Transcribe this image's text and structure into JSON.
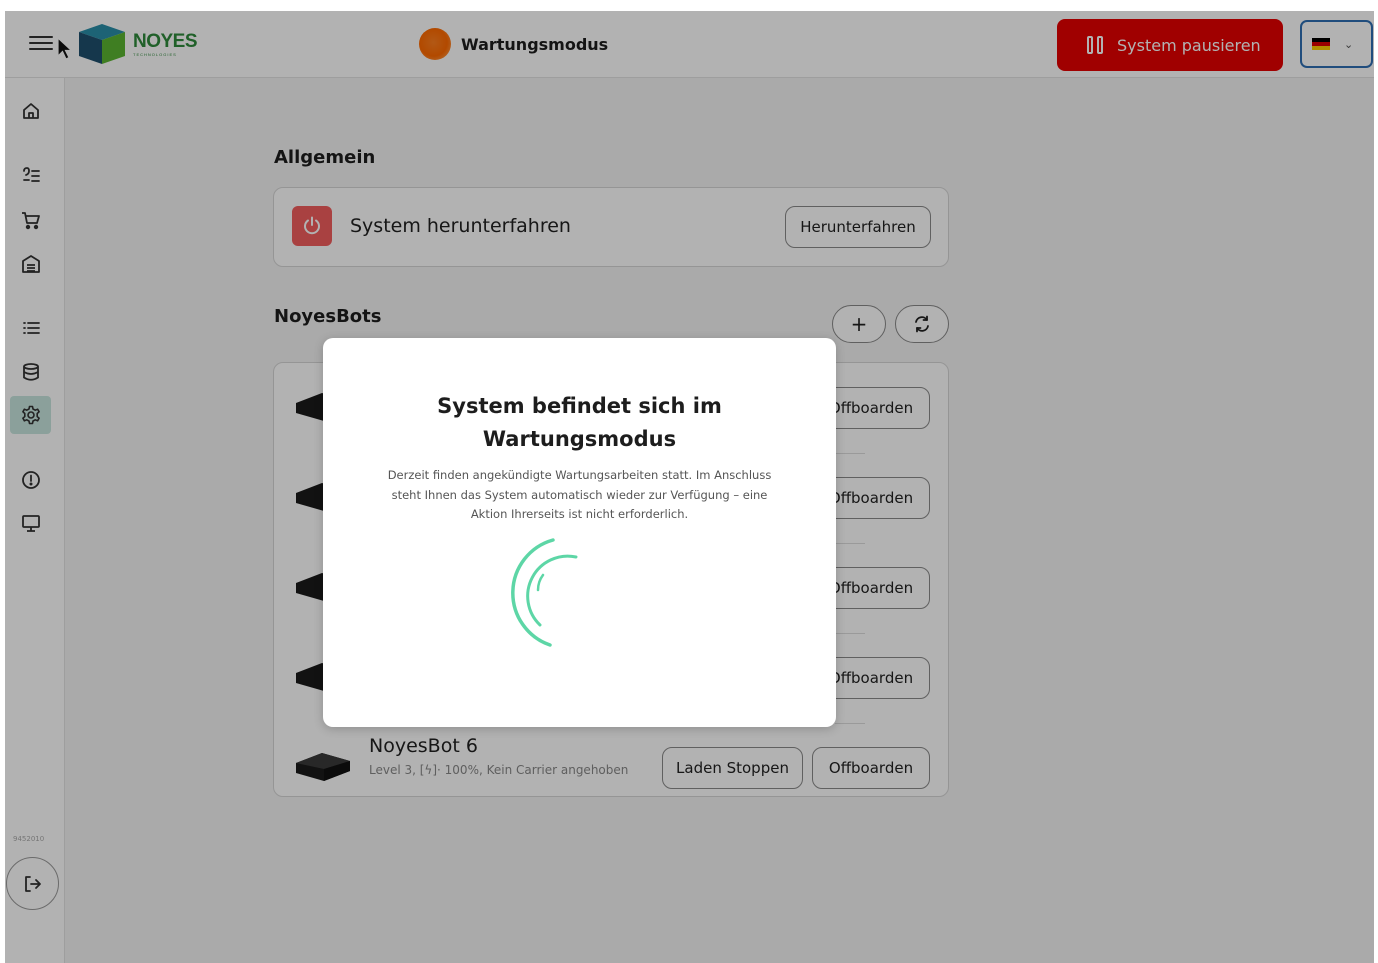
{
  "header": {
    "logo_name": "NOYES",
    "logo_sub": "TECHNOLOGIES",
    "mode_label": "Wartungsmodus",
    "pause_label": "System pausieren",
    "language": "de",
    "colors": {
      "pause": "#e60000",
      "mode_dot": "#ff6a00",
      "accent": "#2e8a3c"
    }
  },
  "sidebar": {
    "items": [
      {
        "icon": "home-icon",
        "active": false
      },
      {
        "icon": "order-list-icon",
        "active": false
      },
      {
        "icon": "cart-icon",
        "active": false
      },
      {
        "icon": "storage-icon",
        "active": false
      },
      {
        "icon": "list-icon",
        "active": false
      },
      {
        "icon": "database-icon",
        "active": false
      },
      {
        "icon": "settings-icon",
        "active": true
      },
      {
        "icon": "alert-icon",
        "active": false
      },
      {
        "icon": "monitor-icon",
        "active": false
      }
    ],
    "version": "9452010",
    "logout_icon": "logout-icon"
  },
  "main": {
    "general": {
      "title": "Allgemein",
      "shutdown_label": "System herunterfahren",
      "shutdown_button": "Herunterfahren"
    },
    "bots": {
      "title": "NoyesBots",
      "add_label": "+",
      "rows": [
        {
          "offboard_label": "Offboarden"
        },
        {
          "offboard_label": "Offboarden"
        },
        {
          "offboard_label": "Offboarden"
        },
        {
          "offboard_label": "Offboarden"
        },
        {
          "name": "NoyesBot 6",
          "info": "Level 3, [ϟ]· 100%, Kein Carrier angehoben",
          "stop_label": "Laden Stoppen",
          "offboard_label": "Offboarden"
        }
      ]
    }
  },
  "modal": {
    "title": "System befindet sich im Wartungsmodus",
    "text": "Derzeit finden angekündigte Wartungsarbeiten statt. Im Anschluss steht Ihnen das System automatisch wieder zur Verfügung – eine Aktion Ihrerseits ist nicht erforderlich.",
    "spinner_color": "#5dd6a6"
  }
}
